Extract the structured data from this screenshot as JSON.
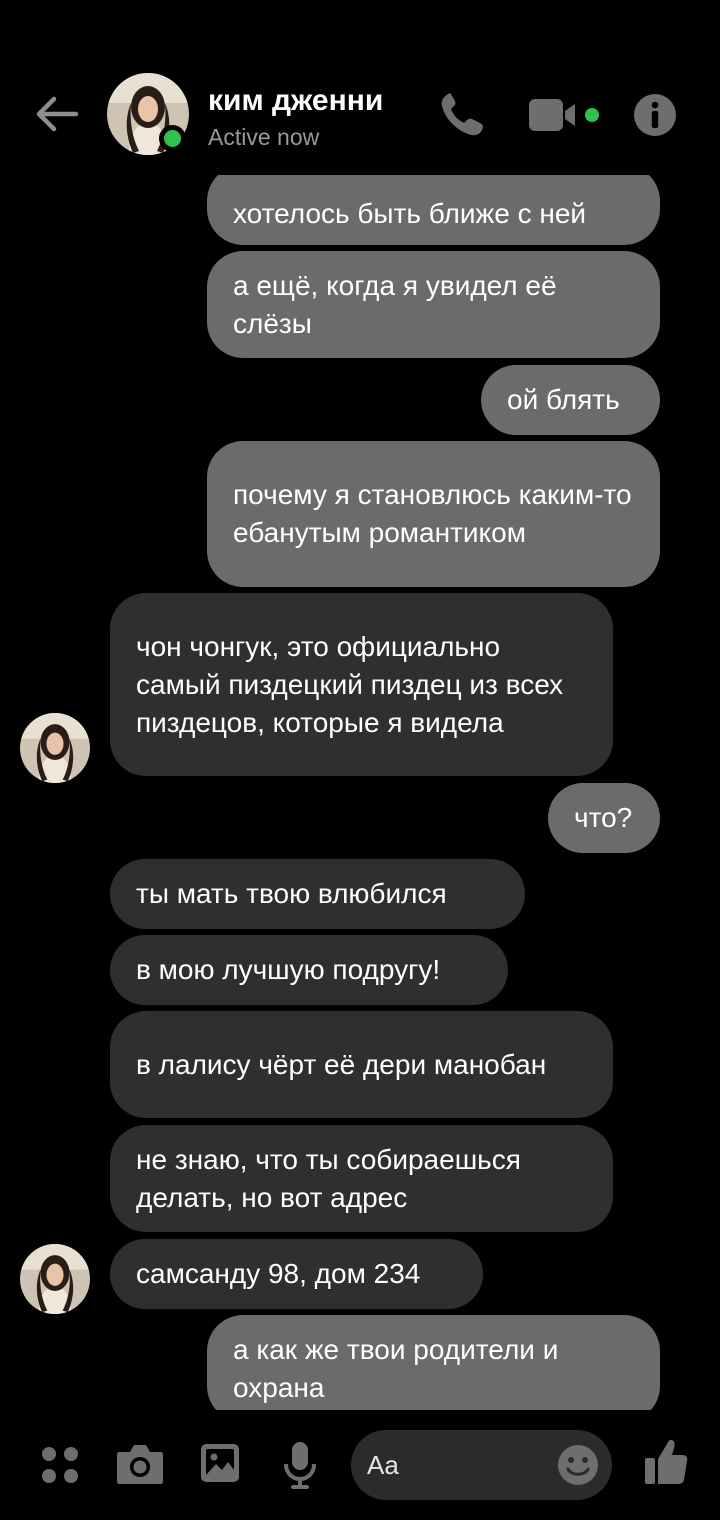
{
  "header": {
    "contact_name": "ким дженни",
    "status": "Active now"
  },
  "messages": [
    {
      "side": "out",
      "text": "хотелось быть ближе с ней"
    },
    {
      "side": "out",
      "text": "а ещё, когда я увидел её слёзы"
    },
    {
      "side": "out",
      "text": "ой блять"
    },
    {
      "side": "out",
      "text": "почему я становлюсь каким-то ебанутым романтиком"
    },
    {
      "side": "in",
      "text": "чон чонгук, это официально самый пиздецкий пиздец из всех пиздецов, которые я видела"
    },
    {
      "side": "out",
      "text": "что?"
    },
    {
      "side": "in",
      "text": "ты мать твою влюбился"
    },
    {
      "side": "in",
      "text": "в мою лучшую подругу!"
    },
    {
      "side": "in",
      "text": "в лалису чёрт её дери манобан"
    },
    {
      "side": "in",
      "text": "не знаю, что ты собираешься делать, но вот адрес"
    },
    {
      "side": "in",
      "text": "самсанду 98, дом 234"
    },
    {
      "side": "out",
      "text": "а как же твои родители и охрана"
    }
  ],
  "composer": {
    "placeholder": "Aa"
  },
  "colors": {
    "online": "#31c24d",
    "outgoing_bubble": "#6b6b6d",
    "incoming_bubble": "#2f2f31"
  },
  "icons": [
    "back-arrow-icon",
    "phone-icon",
    "video-camera-icon",
    "info-icon",
    "menu-dots-icon",
    "camera-icon",
    "gallery-icon",
    "microphone-icon",
    "emoji-icon",
    "thumbs-up-icon"
  ]
}
